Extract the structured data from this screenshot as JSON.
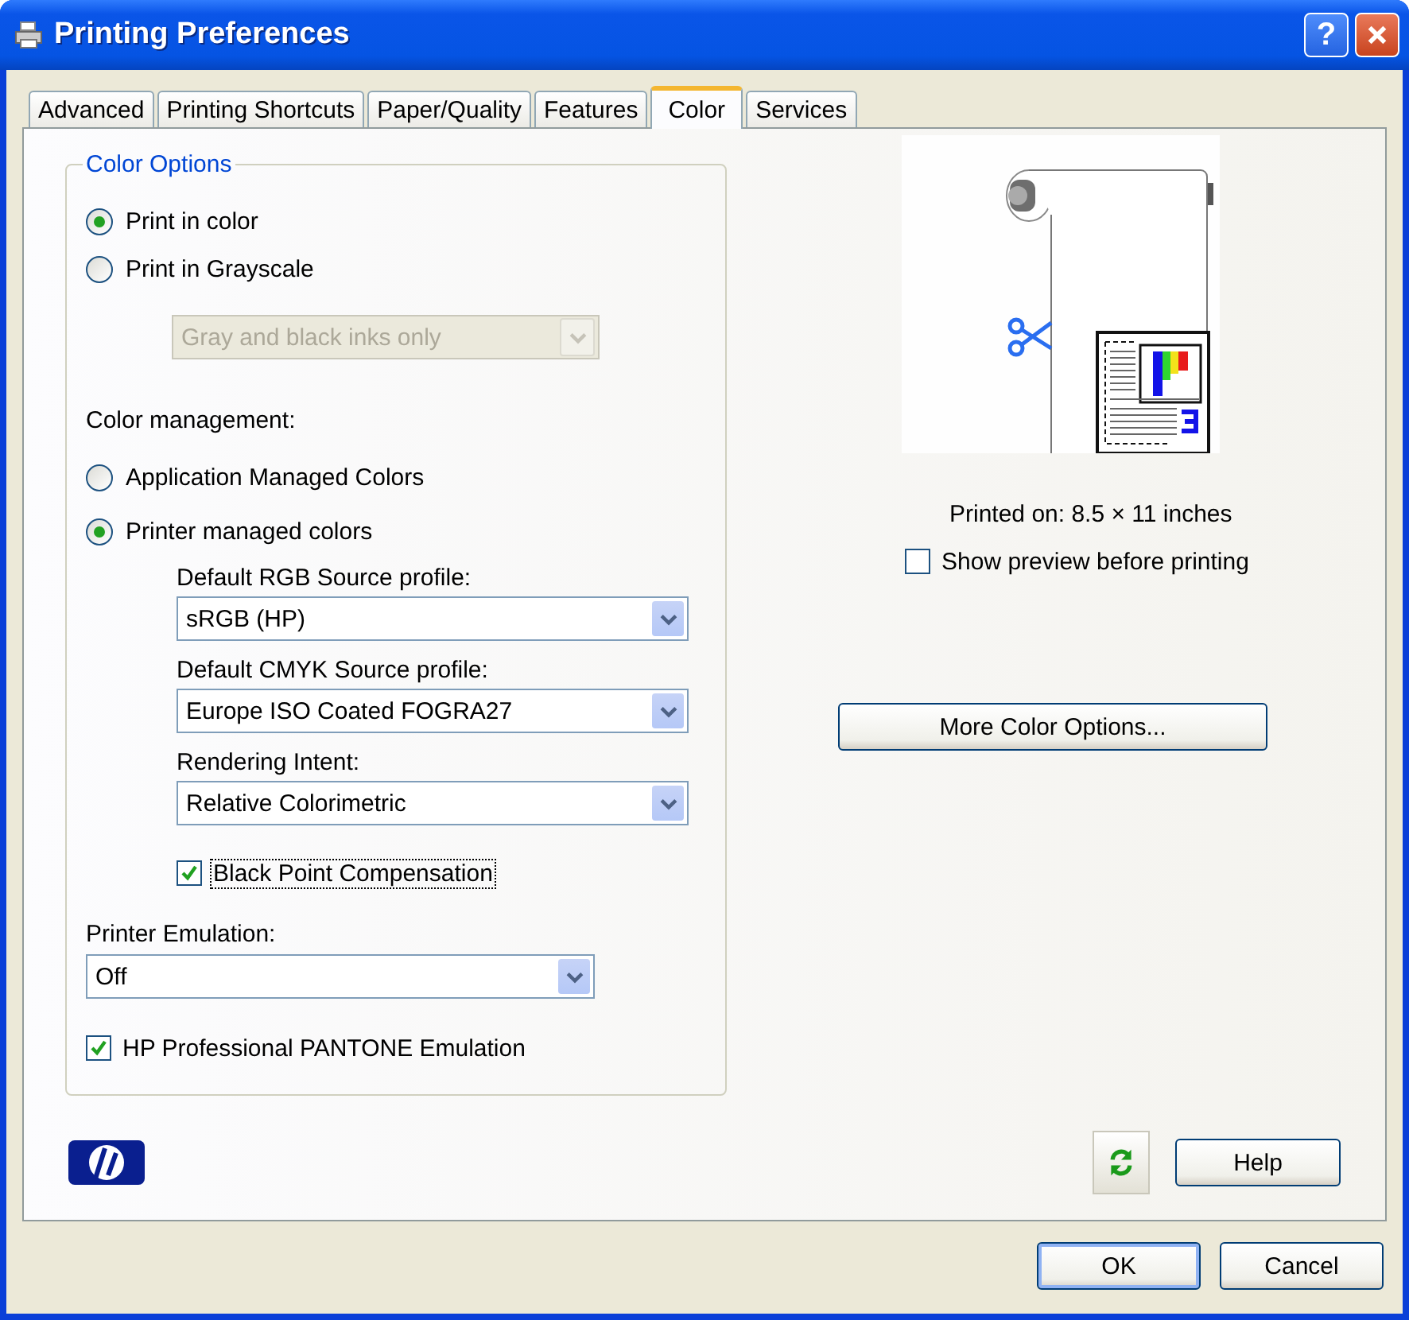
{
  "window": {
    "title": "Printing Preferences",
    "help_glyph": "?"
  },
  "tabs": [
    {
      "label": "Advanced",
      "selected": false
    },
    {
      "label": "Printing Shortcuts",
      "selected": false
    },
    {
      "label": "Paper/Quality",
      "selected": false
    },
    {
      "label": "Features",
      "selected": false
    },
    {
      "label": "Color",
      "selected": true
    },
    {
      "label": "Services",
      "selected": false
    }
  ],
  "color_options": {
    "legend": "Color Options",
    "modes": [
      {
        "label": "Print in color",
        "selected": true
      },
      {
        "label": "Print in Grayscale",
        "selected": false
      }
    ],
    "grayscale_dropdown": {
      "value": "Gray and black inks only",
      "disabled": true
    },
    "management_label": "Color management:",
    "management": [
      {
        "label": "Application Managed Colors",
        "selected": false
      },
      {
        "label": "Printer managed colors",
        "selected": true
      }
    ],
    "profiles": [
      {
        "label": "Default RGB Source profile:",
        "value": "sRGB (HP)"
      },
      {
        "label": "Default CMYK Source profile:",
        "value": "Europe ISO Coated FOGRA27"
      },
      {
        "label": "Rendering Intent:",
        "value": "Relative Colorimetric"
      }
    ],
    "black_point": {
      "label": "Black Point Compensation",
      "checked": true,
      "focused": true
    },
    "emulation": {
      "label": "Printer Emulation:",
      "value": "Off"
    },
    "pantone": {
      "label": "HP Professional PANTONE Emulation",
      "checked": true,
      "focused": false
    }
  },
  "preview": {
    "caption": "Printed on: 8.5 × 11 inches",
    "show_preview": {
      "label": "Show preview before printing",
      "checked": false,
      "focused": false
    },
    "more_button": "More Color Options..."
  },
  "help_button": "Help",
  "dialog_buttons": [
    {
      "label": "OK",
      "default": true
    },
    {
      "label": "Cancel",
      "default": false
    }
  ]
}
